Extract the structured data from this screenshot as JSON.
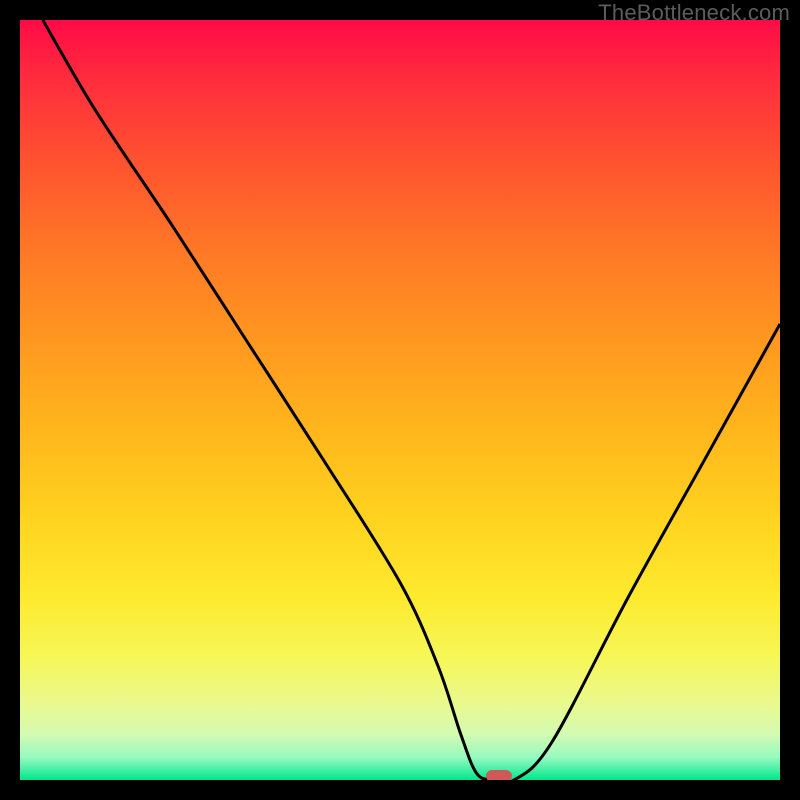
{
  "watermark": "TheBottleneck.com",
  "chart_data": {
    "type": "line",
    "title": "",
    "xlabel": "",
    "ylabel": "",
    "xlim": [
      0,
      100
    ],
    "ylim": [
      0,
      100
    ],
    "x": [
      3,
      10,
      20,
      30,
      40,
      50,
      55,
      58,
      60,
      62,
      65,
      70,
      80,
      90,
      100
    ],
    "values": [
      100,
      88,
      73,
      57.5,
      42,
      26,
      15,
      6,
      1,
      0,
      0,
      5,
      24,
      42,
      60
    ],
    "marker": {
      "x": 63,
      "y": 0.5
    },
    "background": "heatmap-gradient"
  }
}
